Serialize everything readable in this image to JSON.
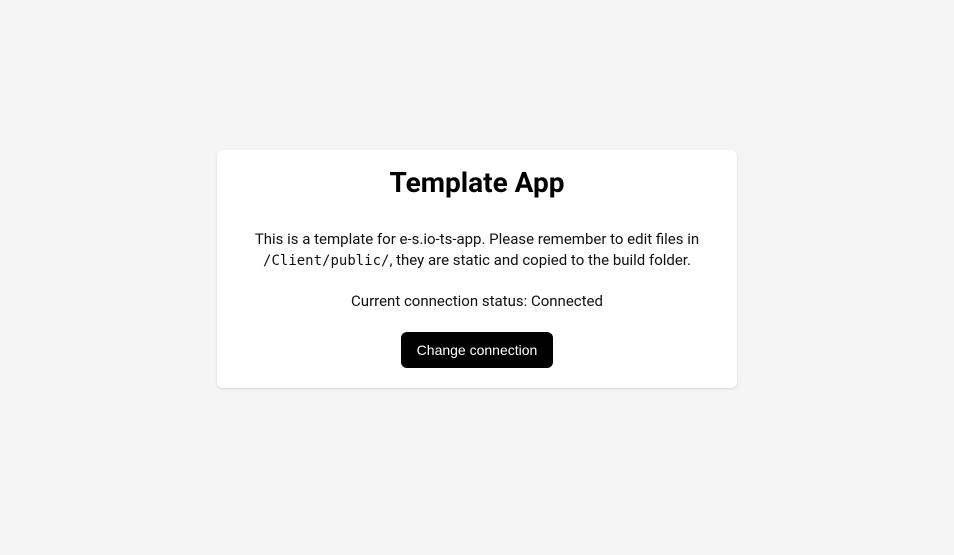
{
  "card": {
    "title": "Template App",
    "description_pre": "This is a template for e-s.io-ts-app. Please remember to edit files in ",
    "description_code": "/Client/public/",
    "description_post": ", they are static and copied to the build folder.",
    "status_label": "Current connection status: ",
    "status_value": "Connected",
    "button_label": "Change connection"
  }
}
